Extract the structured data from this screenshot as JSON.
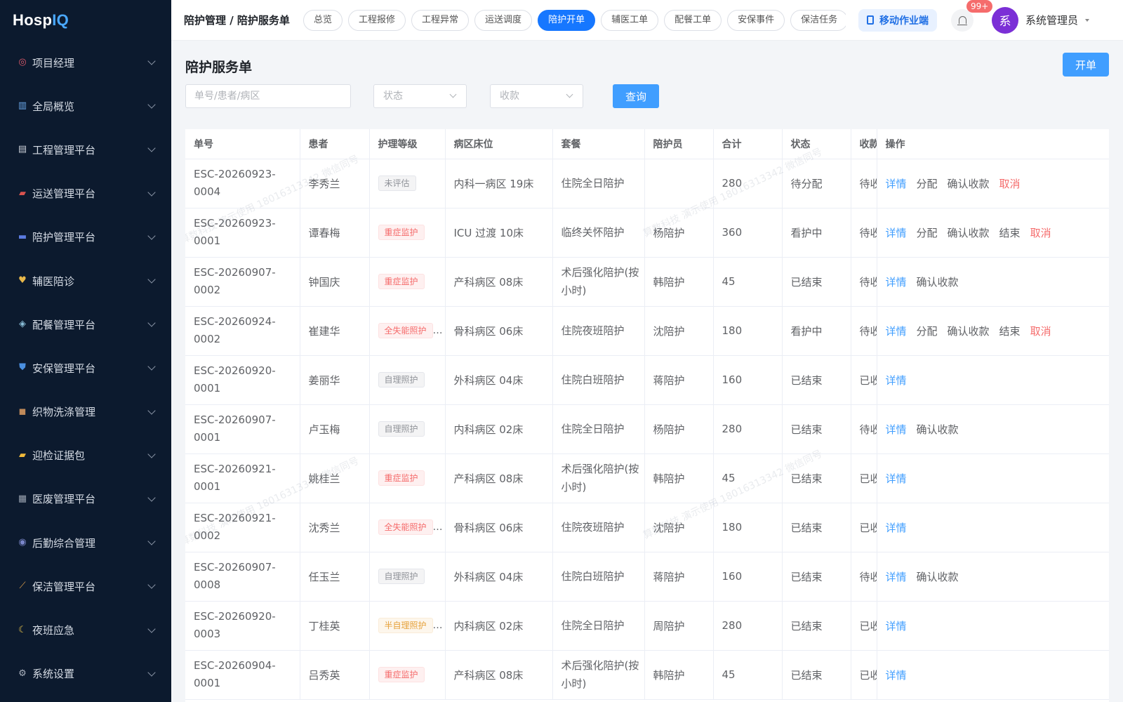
{
  "app": {
    "logo_main": "Hosp",
    "logo_accent": "IQ"
  },
  "sidebar": {
    "items": [
      {
        "label": "项目经理",
        "icon": "target-icon",
        "glyph": "◎",
        "color": "#e05a6a"
      },
      {
        "label": "全局概览",
        "icon": "chart-icon",
        "glyph": "▥",
        "color": "#6aa7e8"
      },
      {
        "label": "工程管理平台",
        "icon": "clipboard-icon",
        "glyph": "▤",
        "color": "#c9ced6"
      },
      {
        "label": "运送管理平台",
        "icon": "truck-icon",
        "glyph": "▰",
        "color": "#d9534f"
      },
      {
        "label": "陪护管理平台",
        "icon": "bed-icon",
        "glyph": "▬",
        "color": "#5b7be0"
      },
      {
        "label": "辅医陪诊",
        "icon": "heart-icon",
        "glyph": "♥",
        "color": "#e8b84a"
      },
      {
        "label": "配餐管理平台",
        "icon": "meal-icon",
        "glyph": "◈",
        "color": "#8bbfd9"
      },
      {
        "label": "安保管理平台",
        "icon": "shield-icon",
        "glyph": "⛊",
        "color": "#4a8fe0"
      },
      {
        "label": "织物洗涤管理",
        "icon": "basket-icon",
        "glyph": "◼",
        "color": "#c08a5a"
      },
      {
        "label": "迎检证据包",
        "icon": "folder-icon",
        "glyph": "▰",
        "color": "#f0b93a"
      },
      {
        "label": "医废管理平台",
        "icon": "trash-icon",
        "glyph": "▦",
        "color": "#9aa3b0"
      },
      {
        "label": "后勤综合管理",
        "icon": "people-icon",
        "glyph": "◉",
        "color": "#7a86c9"
      },
      {
        "label": "保洁管理平台",
        "icon": "broom-icon",
        "glyph": "⟋",
        "color": "#e0a04a"
      },
      {
        "label": "夜班应急",
        "icon": "moon-icon",
        "glyph": "☾",
        "color": "#f0c94a"
      },
      {
        "label": "系统设置",
        "icon": "gear-icon",
        "glyph": "⚙",
        "color": "#aab2be"
      }
    ]
  },
  "header": {
    "breadcrumb": "陪护管理 / 陪护服务单",
    "tabs": [
      "总览",
      "工程报修",
      "工程异常",
      "运送调度",
      "陪护开单",
      "辅医工单",
      "配餐工单",
      "安保事件",
      "保洁任务"
    ],
    "active_tab": 4,
    "mobile_button": "移动作业端",
    "notification_badge": "99+",
    "avatar_text": "系",
    "user_name": "系统管理员"
  },
  "page": {
    "title": "陪护服务单",
    "open_button": "开单",
    "search_placeholder": "单号/患者/病区",
    "status_placeholder": "状态",
    "payment_placeholder": "收款",
    "query_button": "查询"
  },
  "table": {
    "columns": [
      "单号",
      "患者",
      "护理等级",
      "病区床位",
      "套餐",
      "陪护员",
      "合计",
      "状态",
      "收款",
      "操作"
    ],
    "rows": [
      {
        "no": "ESC-20260923-0004",
        "patient": "李秀兰",
        "level": "未评估",
        "level_style": "grey",
        "level_ellipsis": "",
        "ward": "内科一病区 19床",
        "pkg": "住院全日陪护",
        "escort": "",
        "total": "280",
        "status": "待分配",
        "pay": "待收",
        "ops": [
          [
            "详情",
            "detail"
          ],
          [
            "分配",
            "normal"
          ],
          [
            "确认收款",
            "normal"
          ],
          [
            "取消",
            "danger"
          ]
        ]
      },
      {
        "no": "ESC-20260923-0001",
        "patient": "谭春梅",
        "level": "重症监护",
        "level_style": "red",
        "level_ellipsis": "",
        "ward": "ICU 过渡 10床",
        "pkg": "临终关怀陪护",
        "escort": "杨陪护",
        "total": "360",
        "status": "看护中",
        "pay": "待收",
        "ops": [
          [
            "详情",
            "detail"
          ],
          [
            "分配",
            "normal"
          ],
          [
            "确认收款",
            "normal"
          ],
          [
            "结束",
            "normal"
          ],
          [
            "取消",
            "danger"
          ]
        ]
      },
      {
        "no": "ESC-20260907-0002",
        "patient": "钟国庆",
        "level": "重症监护",
        "level_style": "red",
        "level_ellipsis": "",
        "ward": "产科病区 08床",
        "pkg": "术后强化陪护(按小时)",
        "escort": "韩陪护",
        "total": "45",
        "status": "已结束",
        "pay": "待收",
        "ops": [
          [
            "详情",
            "detail"
          ],
          [
            "确认收款",
            "normal"
          ]
        ]
      },
      {
        "no": "ESC-20260924-0002",
        "patient": "崔建华",
        "level": "全失能照护",
        "level_style": "red",
        "level_ellipsis": "…",
        "ward": "骨科病区 06床",
        "pkg": "住院夜班陪护",
        "escort": "沈陪护",
        "total": "180",
        "status": "看护中",
        "pay": "待收",
        "ops": [
          [
            "详情",
            "detail"
          ],
          [
            "分配",
            "normal"
          ],
          [
            "确认收款",
            "normal"
          ],
          [
            "结束",
            "normal"
          ],
          [
            "取消",
            "danger"
          ]
        ]
      },
      {
        "no": "ESC-20260920-0001",
        "patient": "姜丽华",
        "level": "自理照护",
        "level_style": "grey",
        "level_ellipsis": "",
        "ward": "外科病区 04床",
        "pkg": "住院白班陪护",
        "escort": "蒋陪护",
        "total": "160",
        "status": "已结束",
        "pay": "已收",
        "ops": [
          [
            "详情",
            "detail"
          ]
        ]
      },
      {
        "no": "ESC-20260907-0001",
        "patient": "卢玉梅",
        "level": "自理照护",
        "level_style": "grey",
        "level_ellipsis": "",
        "ward": "内科病区 02床",
        "pkg": "住院全日陪护",
        "escort": "杨陪护",
        "total": "280",
        "status": "已结束",
        "pay": "待收",
        "ops": [
          [
            "详情",
            "detail"
          ],
          [
            "确认收款",
            "normal"
          ]
        ]
      },
      {
        "no": "ESC-20260921-0001",
        "patient": "姚桂兰",
        "level": "重症监护",
        "level_style": "red",
        "level_ellipsis": "",
        "ward": "产科病区 08床",
        "pkg": "术后强化陪护(按小时)",
        "escort": "韩陪护",
        "total": "45",
        "status": "已结束",
        "pay": "已收",
        "ops": [
          [
            "详情",
            "detail"
          ]
        ]
      },
      {
        "no": "ESC-20260921-0002",
        "patient": "沈秀兰",
        "level": "全失能照护",
        "level_style": "red",
        "level_ellipsis": "…",
        "ward": "骨科病区 06床",
        "pkg": "住院夜班陪护",
        "escort": "沈陪护",
        "total": "180",
        "status": "已结束",
        "pay": "已收",
        "ops": [
          [
            "详情",
            "detail"
          ]
        ]
      },
      {
        "no": "ESC-20260907-0008",
        "patient": "任玉兰",
        "level": "自理照护",
        "level_style": "grey",
        "level_ellipsis": "",
        "ward": "外科病区 04床",
        "pkg": "住院白班陪护",
        "escort": "蒋陪护",
        "total": "160",
        "status": "已结束",
        "pay": "待收",
        "ops": [
          [
            "详情",
            "detail"
          ],
          [
            "确认收款",
            "normal"
          ]
        ]
      },
      {
        "no": "ESC-20260920-0003",
        "patient": "丁桂英",
        "level": "半自理照护",
        "level_style": "orange",
        "level_ellipsis": "…",
        "ward": "内科病区 02床",
        "pkg": "住院全日陪护",
        "escort": "周陪护",
        "total": "280",
        "status": "已结束",
        "pay": "已收",
        "ops": [
          [
            "详情",
            "detail"
          ]
        ]
      },
      {
        "no": "ESC-20260904-0001",
        "patient": "吕秀英",
        "level": "重症监护",
        "level_style": "red",
        "level_ellipsis": "",
        "ward": "产科病区 08床",
        "pkg": "术后强化陪护(按小时)",
        "escort": "韩陪护",
        "total": "45",
        "status": "已结束",
        "pay": "已收",
        "ops": [
          [
            "详情",
            "detail"
          ]
        ]
      }
    ]
  },
  "watermark": "算数科技 演示使用 18016313342 微信同号",
  "colors": {
    "primary": "#409eff",
    "active_tab": "#1677ff",
    "danger": "#f56c6c",
    "sidebar_bg": "#0c1a2e",
    "avatar": "#7b2fd6"
  }
}
